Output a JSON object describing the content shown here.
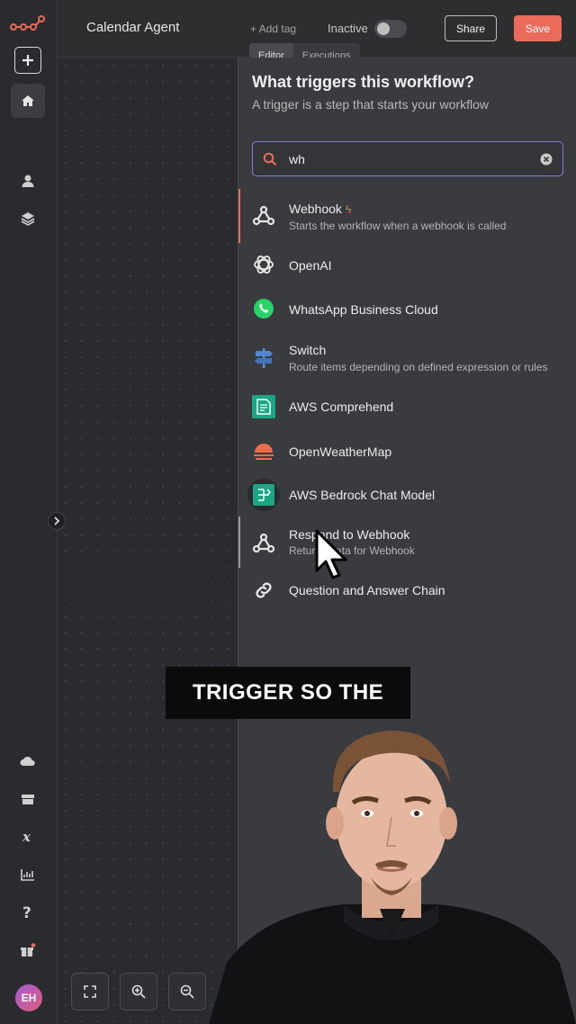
{
  "header": {
    "workflow_title": "Calendar Agent",
    "add_tag": "+ Add tag",
    "status_label": "Inactive",
    "share_label": "Share",
    "save_label": "Save",
    "tabs": [
      {
        "label": "Editor"
      },
      {
        "label": "Executions"
      }
    ]
  },
  "sidebar": {
    "user_initials": "EH",
    "icons": [
      "logo-icon",
      "plus-icon",
      "home-icon",
      "user-icon",
      "layers-icon",
      "cloud-icon",
      "box-icon",
      "variables-icon",
      "chart-icon",
      "help-icon",
      "gift-icon"
    ]
  },
  "panel": {
    "title": "What triggers this workflow?",
    "subtitle": "A trigger is a step that starts your workflow",
    "search_value": "wh",
    "items": [
      {
        "name": "Webhook",
        "description": "Starts the workflow when a webhook is called",
        "icon": "webhook-icon"
      },
      {
        "name": "OpenAI",
        "description": "",
        "icon": "openai-icon"
      },
      {
        "name": "WhatsApp Business Cloud",
        "description": "",
        "icon": "whatsapp-icon"
      },
      {
        "name": "Switch",
        "description": "Route items depending on defined expression or rules",
        "icon": "switch-signpost-icon"
      },
      {
        "name": "AWS Comprehend",
        "description": "",
        "icon": "aws-comprehend-icon"
      },
      {
        "name": "OpenWeatherMap",
        "description": "",
        "icon": "openweathermap-icon"
      },
      {
        "name": "AWS Bedrock Chat Model",
        "description": "",
        "icon": "aws-bedrock-icon"
      },
      {
        "name": "Respond to Webhook",
        "description": "Returns data for Webhook",
        "icon": "webhook-icon"
      },
      {
        "name": "Question and Answer Chain",
        "description": "",
        "icon": "link-chain-icon"
      }
    ]
  },
  "caption": "TRIGGER SO THE",
  "colors": {
    "accent": "#ea6b5a",
    "search_border": "#7b7fd4",
    "panel_bg": "#3a3b3e"
  }
}
